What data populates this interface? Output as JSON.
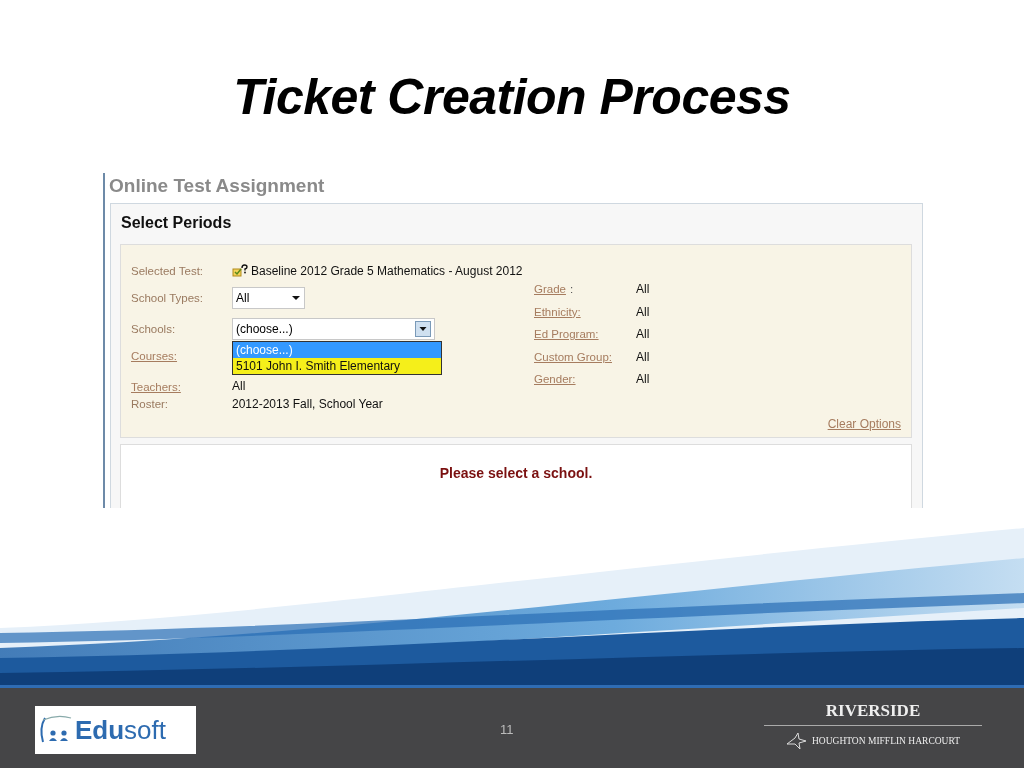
{
  "slide": {
    "title": "Ticket Creation Process",
    "page_number": "11"
  },
  "screenshot": {
    "heading": "Online Test Assignment",
    "panel_title": "Select Periods",
    "fields": [
      {
        "label": "Selected Test:",
        "link": false,
        "kind": "test",
        "value": "Baseline 2012 Grade 5 Mathematics - August 2012"
      },
      {
        "label": "School Types:",
        "link": false,
        "kind": "select",
        "value": "All"
      },
      {
        "label": "Schools:",
        "link": false,
        "kind": "wide-select",
        "value": "(choose...)"
      },
      {
        "label": "Courses:",
        "link": true,
        "kind": "text"
      },
      {
        "label": "Teachers:",
        "link": true,
        "kind": "text",
        "value": "All"
      },
      {
        "label": "Roster:",
        "link": false,
        "kind": "text",
        "value": "2012-2013 Fall, School Year"
      }
    ],
    "school_options": [
      {
        "label": "(choose...)",
        "selected": true,
        "highlighted": false
      },
      {
        "label": "5101 John I. Smith Elementary",
        "selected": false,
        "highlighted": true
      }
    ],
    "filters": [
      {
        "label": "Grade",
        "suffix": ":",
        "value": "All"
      },
      {
        "label": "Ethnicity:",
        "value": "All"
      },
      {
        "label": "Ed Program:",
        "value": "All"
      },
      {
        "label": "Custom Group:",
        "value": "All"
      },
      {
        "label": "Gender:",
        "value": "All"
      }
    ],
    "clear_options": "Clear Options",
    "message": "Please select a school."
  },
  "footer": {
    "left_logo": "**Edu**soft",
    "right_logo": "RIVERSIDE",
    "right_logo_sub": "HOUGHTON MIFFLIN HARCOURT"
  }
}
